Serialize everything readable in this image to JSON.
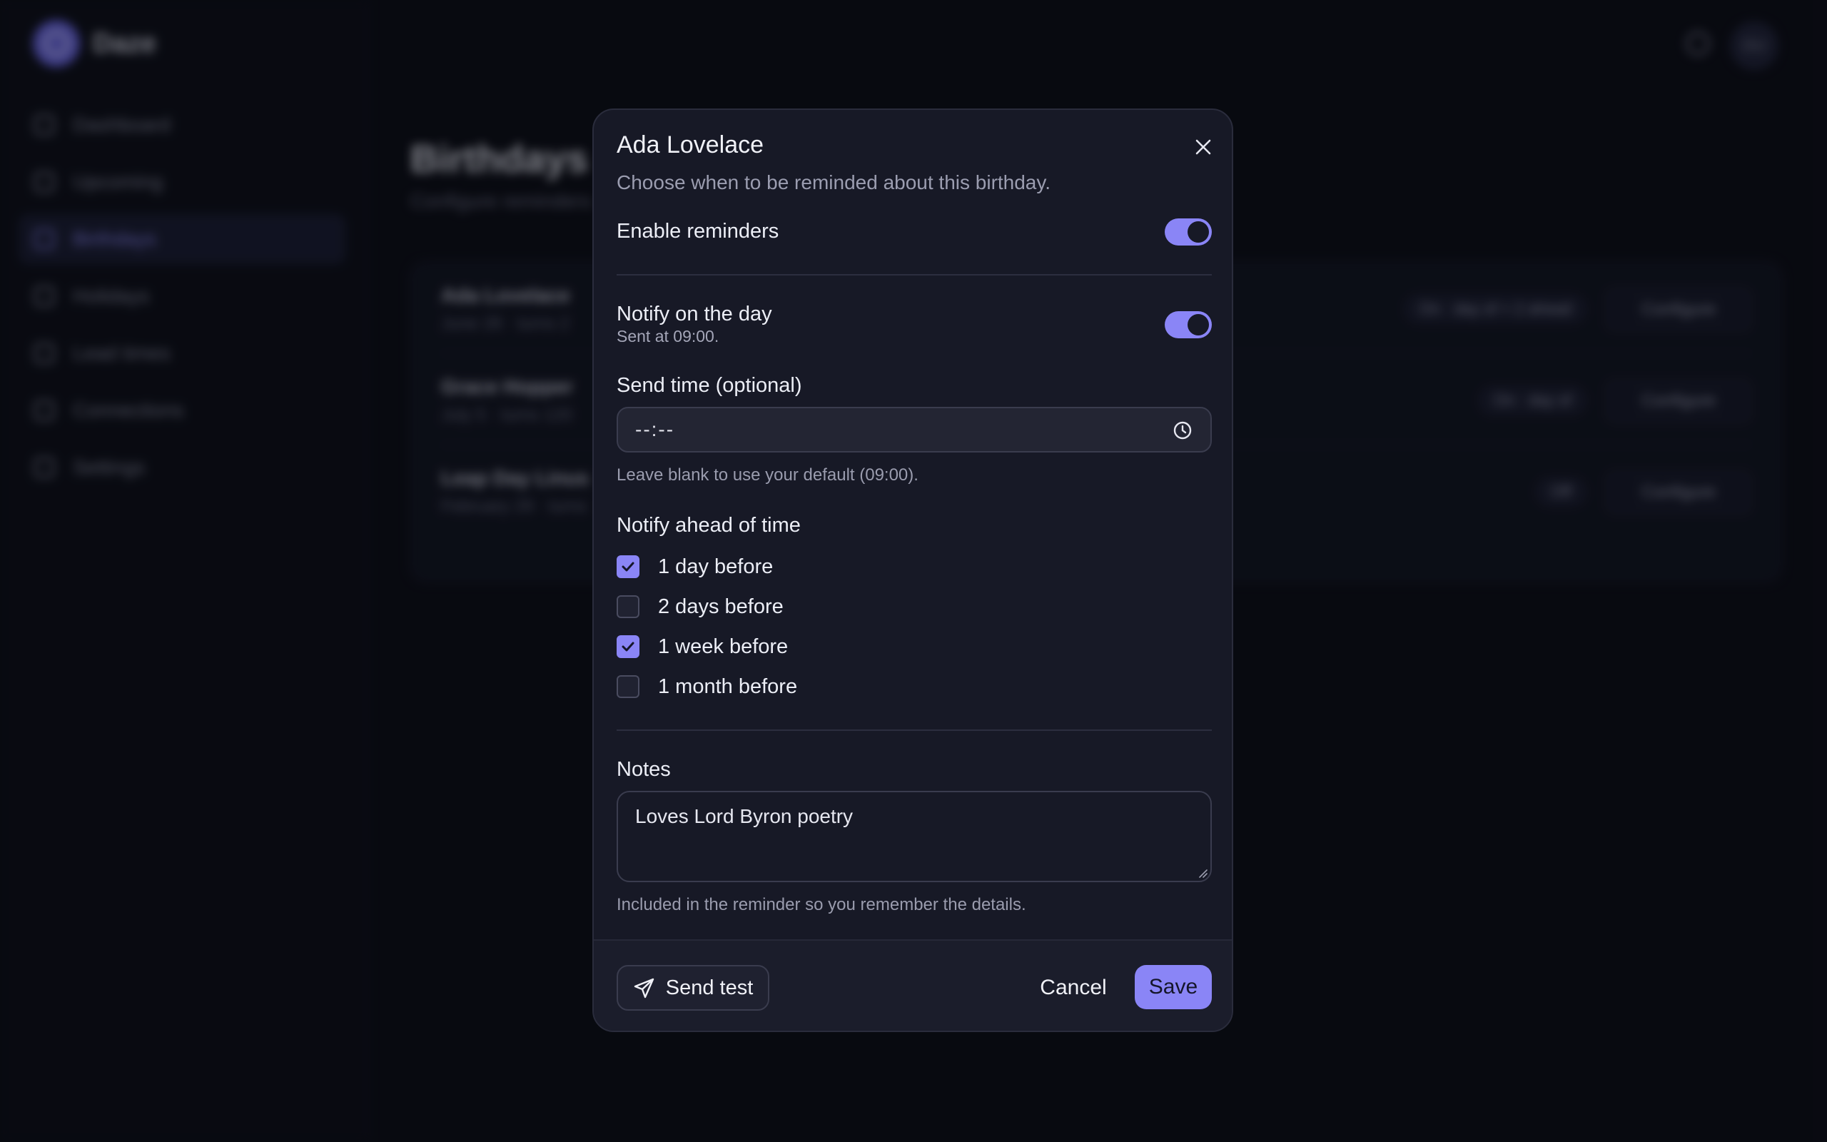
{
  "app": {
    "brand_name": "Daze",
    "nav_items": [
      {
        "label": "Dashboard"
      },
      {
        "label": "Upcoming"
      },
      {
        "label": "Birthdays"
      },
      {
        "label": "Holidays"
      },
      {
        "label": "Lead times"
      },
      {
        "label": "Connections"
      },
      {
        "label": "Settings"
      }
    ],
    "avatar_initials": "DU",
    "page_title": "Birthdays",
    "page_subtitle": "Configure reminders",
    "rows": [
      {
        "name": "Ada Lovelace",
        "meta": "June 28 · turns 2",
        "badge": "On · day of + 2 ahead",
        "action": "Configure"
      },
      {
        "name": "Grace Hopper",
        "meta": "July 5 · turns 120",
        "badge": "On · day of",
        "action": "Configure"
      },
      {
        "name": "Leap Day Linus",
        "meta": "February 29 · turns",
        "badge": "Off",
        "action": "Configure"
      }
    ]
  },
  "modal": {
    "title": "Ada Lovelace",
    "description": "Choose when to be reminded about this birthday.",
    "enable_reminders_label": "Enable reminders",
    "enable_reminders_on": true,
    "notify_day_label": "Notify on the day",
    "notify_day_sub": "Sent at 09:00.",
    "notify_day_on": true,
    "send_time_label": "Send time (optional)",
    "send_time_value": "--:--",
    "send_time_hint": "Leave blank to use your default (09:00).",
    "ahead_label": "Notify ahead of time",
    "ahead_options": [
      {
        "label": "1 day before",
        "checked": true
      },
      {
        "label": "2 days before",
        "checked": false
      },
      {
        "label": "1 week before",
        "checked": true
      },
      {
        "label": "1 month before",
        "checked": false
      }
    ],
    "notes_label": "Notes",
    "notes_value": "Loves Lord Byron poetry",
    "notes_hint": "Included in the reminder so you remember the details.",
    "send_test_label": "Send test",
    "cancel_label": "Cancel",
    "save_label": "Save"
  },
  "colors": {
    "accent": "#8a85f6",
    "modal_bg": "#171926",
    "page_bg": "#0c0d15"
  }
}
